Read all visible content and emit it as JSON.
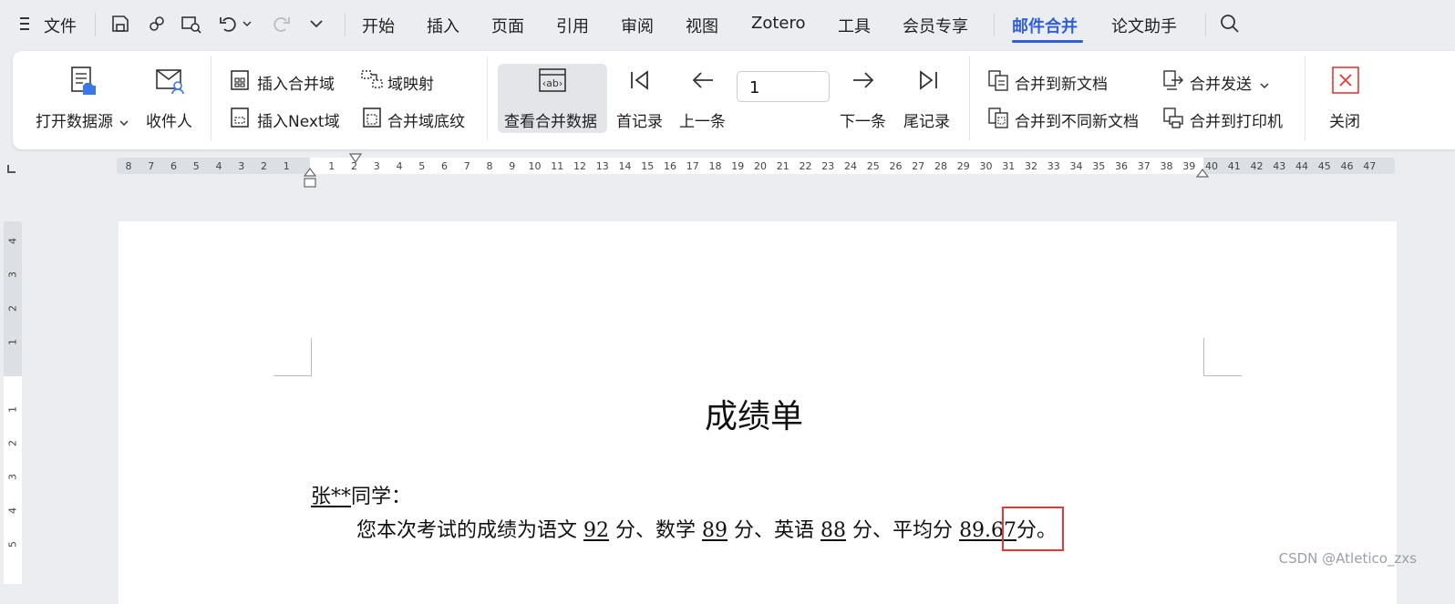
{
  "menu": {
    "file_label": "文件",
    "tabs": [
      "开始",
      "插入",
      "页面",
      "引用",
      "审阅",
      "视图",
      "Zotero",
      "工具",
      "会员专享",
      "邮件合并",
      "论文助手"
    ],
    "active_tab": "邮件合并"
  },
  "ribbon": {
    "open_datasource": "打开数据源",
    "recipients": "收件人",
    "insert_merge_field": "插入合并域",
    "field_mapping": "域映射",
    "insert_next_field": "插入Next域",
    "merge_field_shading": "合并域底纹",
    "view_merged_data": "查看合并数据",
    "first_record": "首记录",
    "prev_record": "上一条",
    "record_number": "1",
    "next_record": "下一条",
    "last_record": "尾记录",
    "merge_to_new_doc": "合并到新文档",
    "merge_to_different_docs": "合并到不同新文档",
    "merge_send": "合并发送",
    "merge_to_printer": "合并到打印机",
    "close": "关闭"
  },
  "ruler": {
    "left_ticks": [
      "8",
      "7",
      "6",
      "5",
      "4",
      "3",
      "2",
      "1"
    ],
    "right_ticks": [
      "1",
      "2",
      "3",
      "4",
      "5",
      "6",
      "7",
      "8",
      "9",
      "10",
      "11",
      "12",
      "13",
      "14",
      "15",
      "16",
      "17",
      "18",
      "19",
      "20",
      "21",
      "22",
      "23",
      "24",
      "25",
      "26",
      "27",
      "28",
      "29",
      "30",
      "31",
      "32",
      "33",
      "34",
      "35",
      "36",
      "37",
      "38",
      "39",
      "40",
      "41",
      "42",
      "43",
      "44",
      "45",
      "46",
      "47"
    ],
    "vertical_top": [
      "4",
      "3",
      "2",
      "1"
    ],
    "vertical_bottom": [
      "1",
      "2",
      "3",
      "4",
      "5"
    ]
  },
  "document": {
    "title": "成绩单",
    "student_name": "张**",
    "greeting_suffix": "同学：",
    "line_prefix": "您本次考试的成绩为语文",
    "chinese_score": "92",
    "sep1": "分、数学",
    "math_score": "89",
    "sep2": "分、英语",
    "english_score": "88",
    "sep3": "分、平均分",
    "average_score": "89.67",
    "line_suffix": "分。"
  },
  "watermark": "CSDN @Atletico_zxs",
  "colors": {
    "accent": "#2f5fdc",
    "highlight_box": "#e53935",
    "close_icon": "#e53935"
  }
}
